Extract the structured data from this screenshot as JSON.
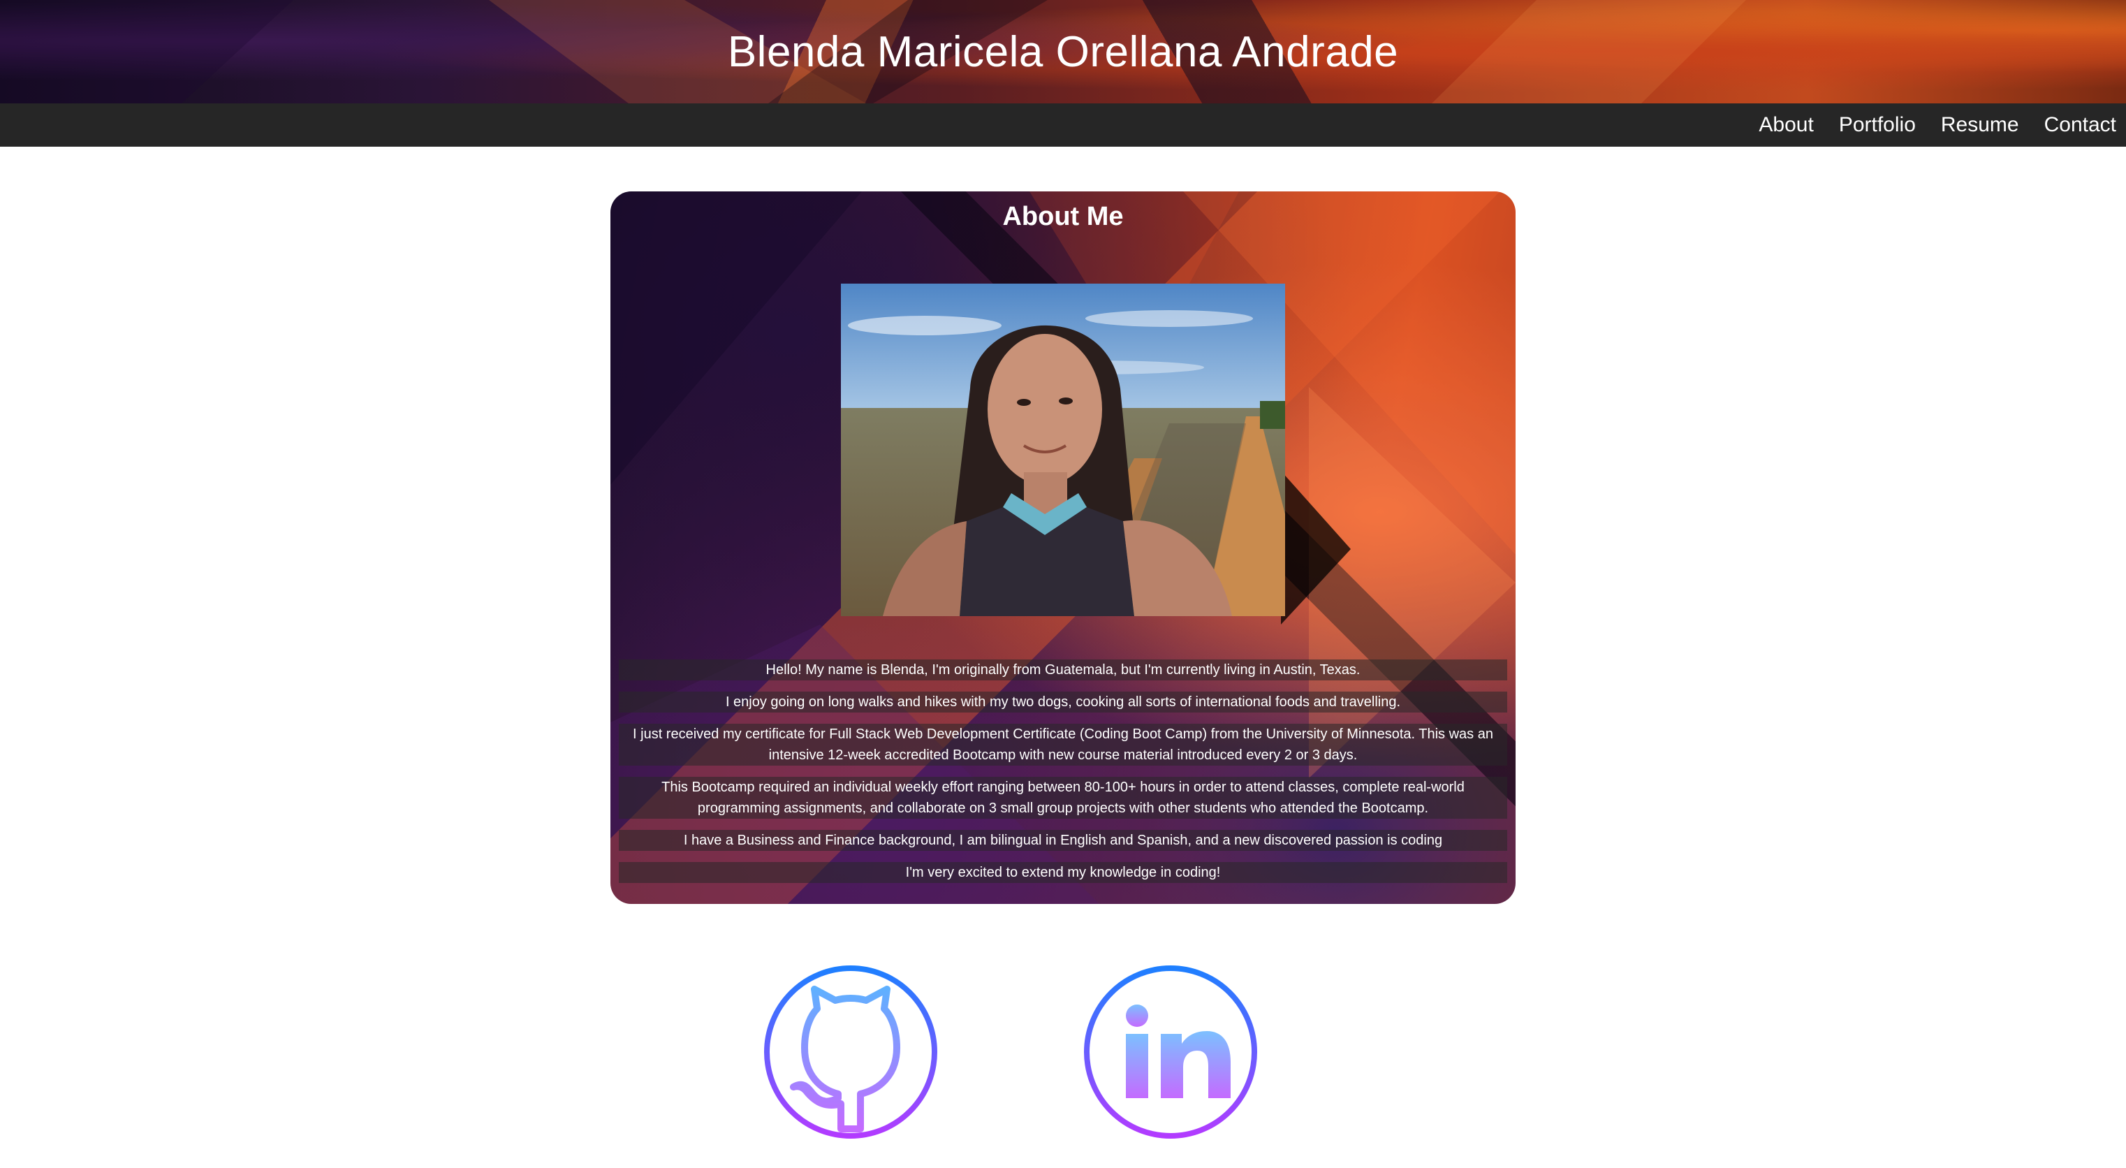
{
  "header": {
    "title": "Blenda Maricela Orellana Andrade"
  },
  "nav": {
    "items": [
      {
        "label": "About"
      },
      {
        "label": "Portfolio"
      },
      {
        "label": "Resume"
      },
      {
        "label": "Contact"
      }
    ]
  },
  "about": {
    "title": "About Me",
    "paragraphs": [
      "Hello! My name is Blenda, I'm originally from Guatemala, but I'm currently living in Austin, Texas.",
      "I enjoy going on long walks and hikes with my two dogs, cooking all sorts of international foods and travelling.",
      "I just received my certificate for Full Stack Web Development Certificate (Coding Boot Camp) from the University of Minnesota. This was an intensive 12-week accredited Bootcamp with new course material introduced every 2 or 3 days.",
      "This Bootcamp required an individual weekly effort ranging between 80-100+ hours in order to attend classes, complete real-world programming assignments, and collaborate on 3 small group projects with other students who attended the Bootcamp.",
      "I have a Business and Finance background, I am bilingual in English and Spanish, and a new discovered passion is coding",
      "I'm very excited to extend my knowledge in coding!"
    ]
  },
  "social": {
    "github_icon": "github-icon",
    "linkedin_icon": "linkedin-icon",
    "linkedin_text": "in",
    "gradient_start": "#1e90ff",
    "gradient_end": "#b23bff"
  },
  "colors": {
    "navbar_bg": "#262626",
    "text_light": "#ffffff"
  }
}
